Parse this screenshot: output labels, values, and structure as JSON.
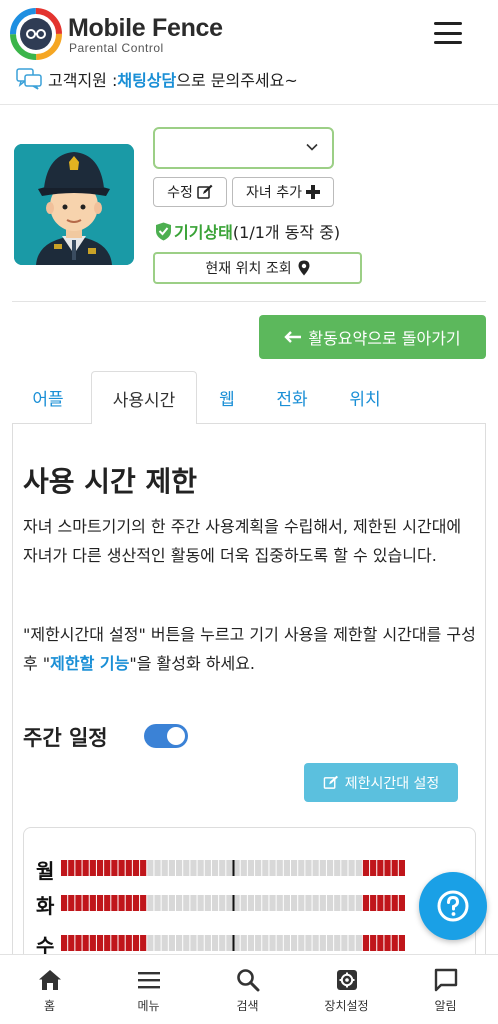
{
  "header": {
    "brand": "Mobile Fence",
    "brand_sub": "Parental Control",
    "menu_icon": "hamburger-icon"
  },
  "support": {
    "prefix": "고객지원 : ",
    "link": "채팅상담",
    "suffix": "으로 문의주세요~"
  },
  "profile": {
    "device_selected": "",
    "edit_label": "수정",
    "add_child_label": "자녀 추가",
    "status_link": "기기상태",
    "status_text": " (1/1개 동작 중)",
    "location_label": "현재 위치 조회"
  },
  "back_button": "활동요약으로 돌아가기",
  "tabs": [
    {
      "label": "어플"
    },
    {
      "label": "사용시간"
    },
    {
      "label": "웹"
    },
    {
      "label": "전화"
    },
    {
      "label": "위치"
    }
  ],
  "section": {
    "title": "사용 시간 제한",
    "desc1": "자녀 스마트기기의 한 주간 사용계획을 수립해서, 제한된 시간대에 자녀가 다른 생산적인 활동에 더욱 집중하도록 할 수 있습니다.",
    "desc2_a": "\"제한시간대 설정\" 버튼을 누르고 기기 사용을 제한할 시간대를 구성 후 \"",
    "desc2_hl": "제한할 기능",
    "desc2_b": "\"을 활성화 하세요."
  },
  "weekly": {
    "label": "주간 일정",
    "enabled": true,
    "limit_button": "제한시간대 설정"
  },
  "schedule": {
    "days": [
      "월",
      "화",
      "수"
    ],
    "slots_per_day": 48,
    "blocked_ranges": [
      [
        0,
        12
      ],
      [
        42,
        48
      ]
    ],
    "colors": {
      "blocked": "#c0161b",
      "free": "#d8d8d8"
    }
  },
  "bottom_nav": [
    {
      "label": "홈",
      "icon": "home-icon"
    },
    {
      "label": "메뉴",
      "icon": "menu-icon"
    },
    {
      "label": "검색",
      "icon": "search-icon"
    },
    {
      "label": "장치설정",
      "icon": "settings-icon"
    },
    {
      "label": "알림",
      "icon": "chat-icon"
    }
  ]
}
